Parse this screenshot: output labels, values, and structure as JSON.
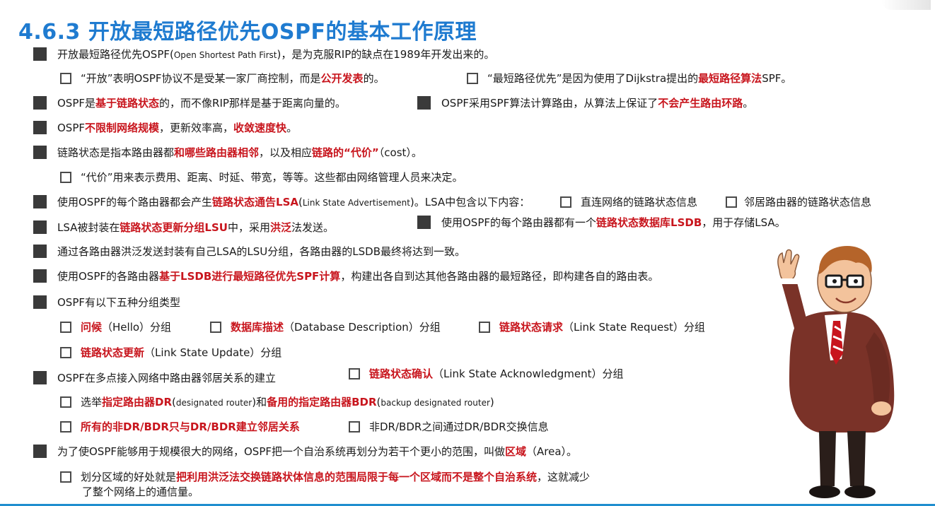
{
  "title": "4.6.3 开放最短路径优先OSPF的基本工作原理",
  "items": {
    "l1": {
      "a": "开放最短路径优先OSPF(",
      "b": "Open Shortest Path First",
      "c": ")，是为克服RIP的缺点在1989年开发出来的。"
    },
    "l2a": {
      "a": "“开放”表明OSPF协议不是受某一家厂商控制，而是",
      "b": "公开发表",
      "c": "的。"
    },
    "l2b": {
      "a": "“最短路径优先”是因为使用了Dijkstra提出的",
      "b": "最短路径算法",
      "c": "SPF。"
    },
    "l3a": {
      "a": "OSPF是",
      "b": "基于链路状态",
      "c": "的，而不像RIP那样是基于距离向量的。"
    },
    "l3b": {
      "a": "OSPF采用SPF算法计算路由，从算法上保证了",
      "b": "不会产生路由环路",
      "c": "。"
    },
    "l4": {
      "a": "OSPF",
      "b": "不限制网络规模",
      "c": "，更新效率高，",
      "d": "收敛速度快",
      "e": "。"
    },
    "l5": {
      "a": "链路状态是指本路由器都",
      "b": "和哪些路由器相邻",
      "c": "，以及相应",
      "d": "链路的“代价”",
      "e": "（cost）。"
    },
    "l6": {
      "a": "“代价”用来表示费用、距离、时延、带宽，等等。这些都由网络管理人员来决定。"
    },
    "l7": {
      "a": "使用OSPF的每个路由器都会产生",
      "b": "链路状态通告LSA",
      "c": "(",
      "d": "Link State Advertisement",
      "e": ")。LSA中包含以下内容："
    },
    "l7b": "直连网络的链路状态信息",
    "l7c": "邻居路由器的链路状态信息",
    "l8a": {
      "a": "LSA被封装在",
      "b": "链路状态更新分组LSU",
      "c": "中，采用",
      "d": "洪泛",
      "e": "法发送。"
    },
    "l8b": {
      "a": "使用OSPF的每个路由器都有一个",
      "b": "链路状态数据库LSDB",
      "c": "，用于存储LSA。"
    },
    "l9": {
      "a": "通过各路由器洪泛发送封装有自己LSA的LSU分组，各路由器的LSDB最终将达到一致。"
    },
    "l10": {
      "a": "使用OSPF的各路由器",
      "b": "基于LSDB进行最短路径优先SPF计算",
      "c": "，构建出各自到达其他各路由器的最短路径，即构建各自的路由表。"
    },
    "l11": {
      "a": "OSPF有以下五种分组类型"
    },
    "p1": {
      "b": "问候",
      "c": "（Hello）分组"
    },
    "p2": {
      "b": "数据库描述",
      "c": "（Database Description）分组"
    },
    "p3": {
      "b": "链路状态请求",
      "c": "（Link State Request）分组"
    },
    "p4": {
      "b": "链路状态更新",
      "c": "（Link State Update）分组"
    },
    "p5": {
      "b": "链路状态确认",
      "c": "（Link State Acknowledgment）分组"
    },
    "l12": {
      "a": "OSPF在多点接入网络中路由器邻居关系的建立"
    },
    "l13": {
      "a": "选举",
      "b": "指定路由器DR",
      "c": "(",
      "d": "designated router",
      "e": ")和",
      "f": "备用的指定路由器BDR",
      "g": "(",
      "h": "backup designated router",
      "i": ")"
    },
    "l14a": {
      "b": "所有的非DR/BDR只与DR/BDR建立邻居关系"
    },
    "l14b": {
      "a": "非DR/BDR之间通过DR/BDR交换信息"
    },
    "l15": {
      "a": "为了使OSPF能够用于规模很大的网络，OSPF把一个自治系统再划分为若干个更小的范围，叫做",
      "b": "区域",
      "c": "（Area）。"
    },
    "l16": {
      "a": "划分区域的好处就是",
      "b": "把利用洪泛法交换链路状体信息的范围局限于每一个区域而不是整个自治系统",
      "c": "，这就减少",
      "d": "了整个网络上的通信量。"
    }
  },
  "colors": {
    "title": "#1f7bd0",
    "highlight": "#c8151d",
    "bullet": "#3a3a3a",
    "rule": "#1f8ecf"
  }
}
